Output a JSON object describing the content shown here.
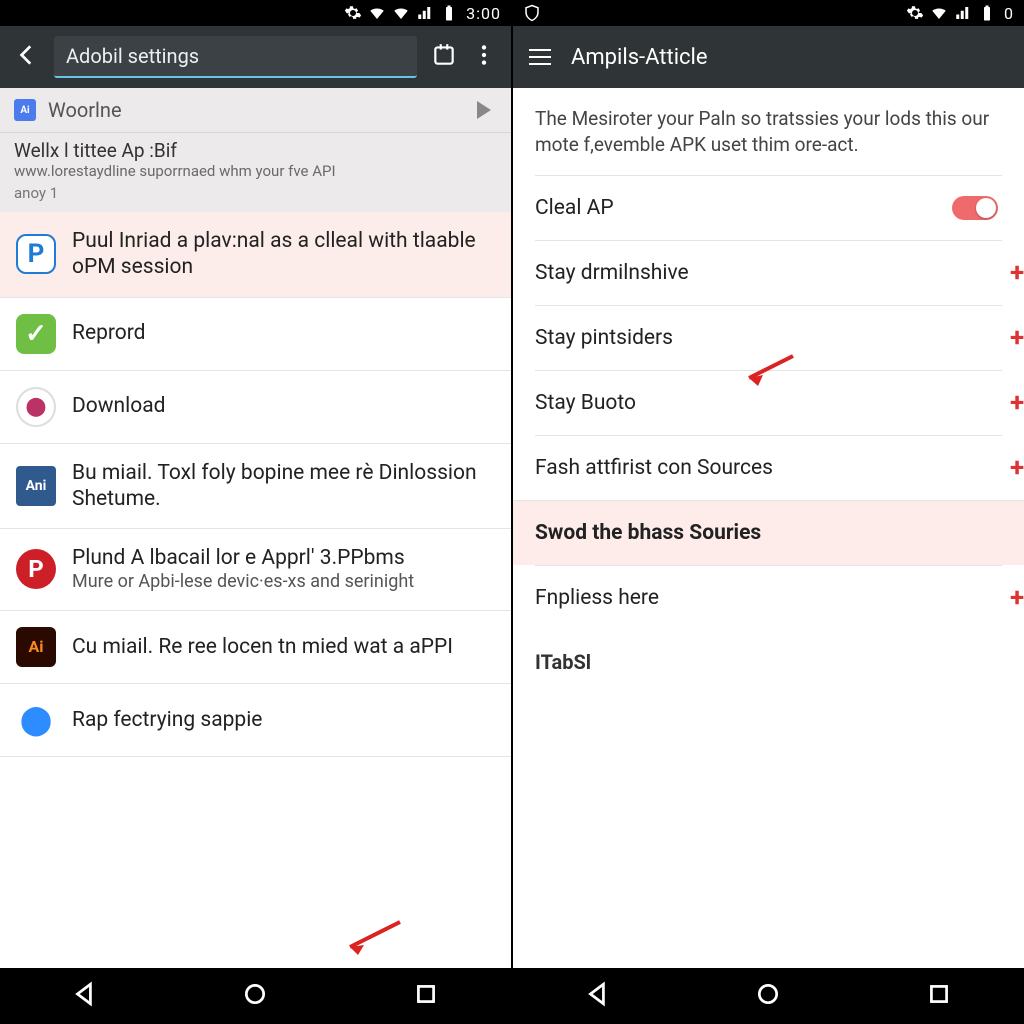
{
  "left": {
    "status": {
      "time": "3:00"
    },
    "app_bar": {
      "title": "Adobil settings"
    },
    "search": {
      "query": "Woorlne",
      "result_title": "Wellx l tittee Ap :Bif",
      "result_url": "www.lorestaydline suporrnaed whm your fve API",
      "result_small": "anoy 1"
    },
    "items": [
      {
        "icon": "p-blue",
        "glyph": "P",
        "text": "Puul Inriad a plav:nal as a clleal with tlaable oPM session",
        "hl": true
      },
      {
        "icon": "check",
        "glyph": "✓",
        "text": "Reprord"
      },
      {
        "icon": "circle",
        "glyph": "⬤",
        "text": "Download"
      },
      {
        "icon": "ani",
        "glyph": "Ani",
        "text": "Bu miail. Toxl foly bopine mee rè Dinlossion Shetume."
      },
      {
        "icon": "pin",
        "glyph": "P",
        "text": "Plund A lbacail lor e Apprl' 3.PPbms",
        "sub": "Mure or Apbi-lese devic·es-xs and serinight"
      },
      {
        "icon": "ai2",
        "glyph": "Ai",
        "text": "Cu miail. Re ree locen tn mied wat a aPPI"
      },
      {
        "icon": "dblue",
        "glyph": "⬤",
        "text": "Rap fectrying sappie"
      }
    ]
  },
  "right": {
    "status": {
      "time": "0"
    },
    "app_bar": {
      "title": "Ampils-Atticle"
    },
    "description": "The Mesiroter your Paln so tratssies your lods this our mote f,evemble APK uset thim ore-act.",
    "rows": [
      {
        "label": "Cleal AP",
        "toggle": true
      },
      {
        "label": "Stay drmilnshive"
      },
      {
        "label": "Stay pintsiders",
        "arrow": true
      },
      {
        "label": "Stay Buoto"
      },
      {
        "label": "Fash attfirist con Sources"
      },
      {
        "label": "Swod the bhass Souries",
        "hl": true,
        "bold": true
      },
      {
        "label": "Fnpliess here"
      }
    ],
    "section": "ITabSl"
  }
}
